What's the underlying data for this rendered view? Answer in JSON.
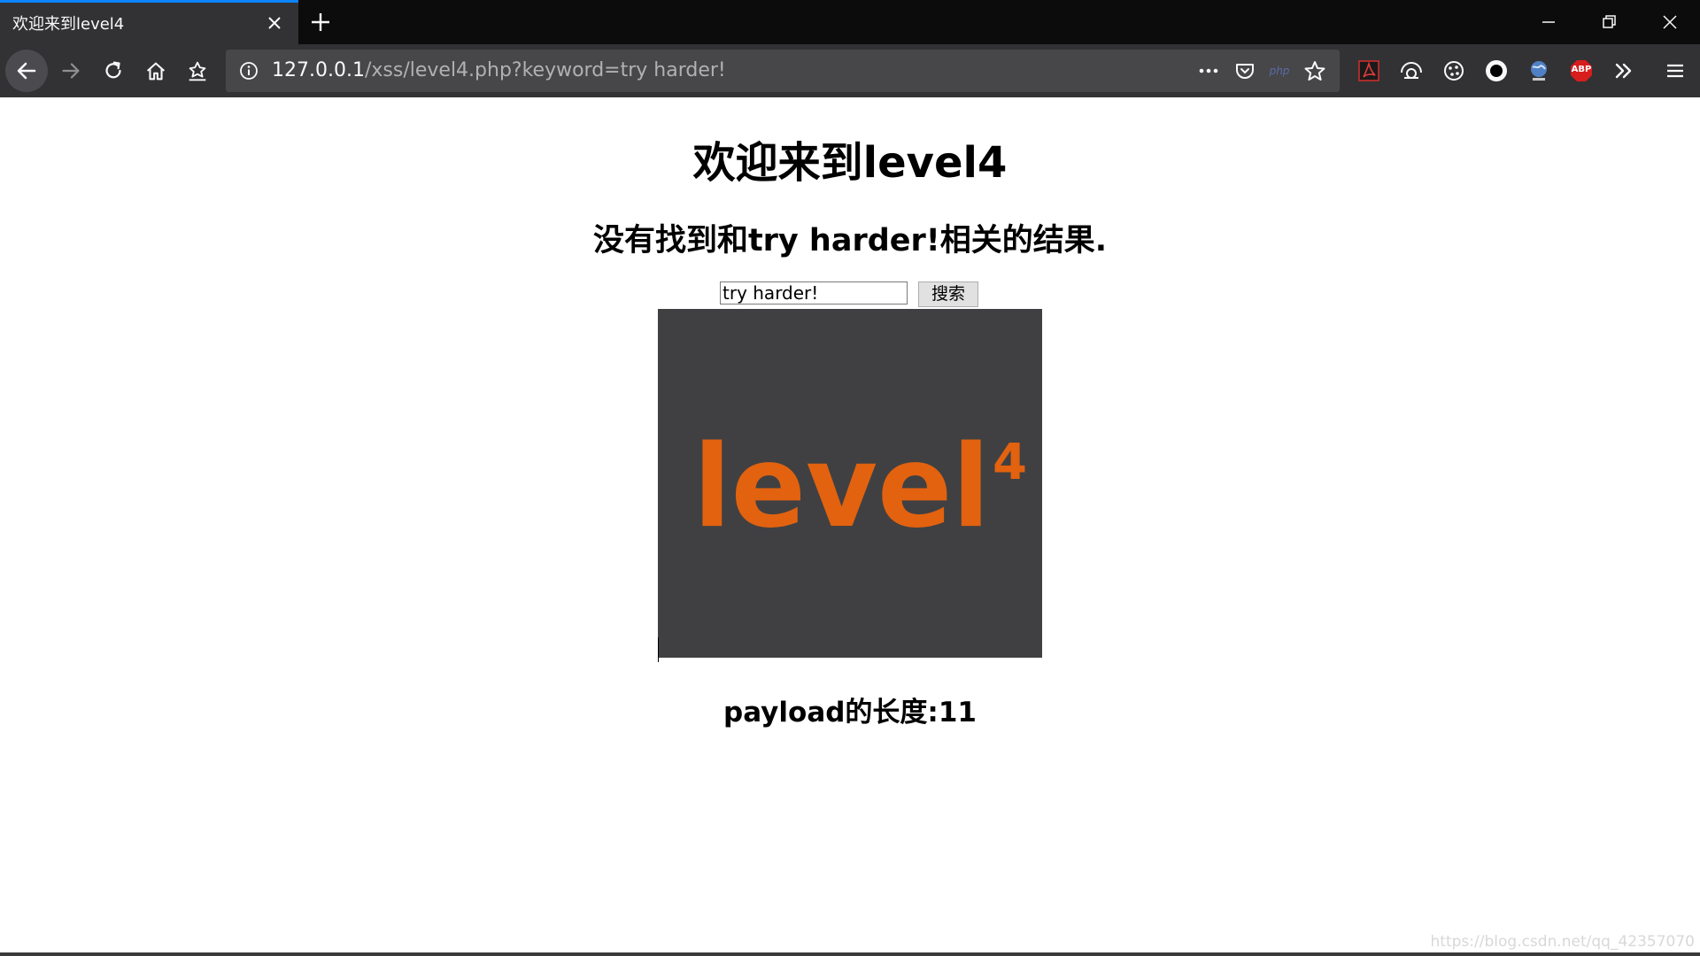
{
  "browser": {
    "tab_title": "欢迎来到level4",
    "url_host": "127.0.0.1",
    "url_rest": "/xss/level4.php?keyword=try harder!",
    "accent_color": "#0a84ff",
    "extensions": [
      "pdf-icon",
      "visual-icon",
      "cookie-icon",
      "circle-icon",
      "globe-icon",
      "adblock-icon"
    ],
    "adblock_label": "ABP",
    "php_label": "php"
  },
  "page": {
    "heading": "欢迎来到level4",
    "result_text": "没有找到和try harder!相关的结果.",
    "search": {
      "value": "try harder!",
      "button_label": "搜索"
    },
    "logo": {
      "word": "level",
      "superscript": "4",
      "color": "#e2620f",
      "background": "#404042"
    },
    "payload_text": "payload的长度:11"
  },
  "watermark": "https://blog.csdn.net/qq_42357070"
}
